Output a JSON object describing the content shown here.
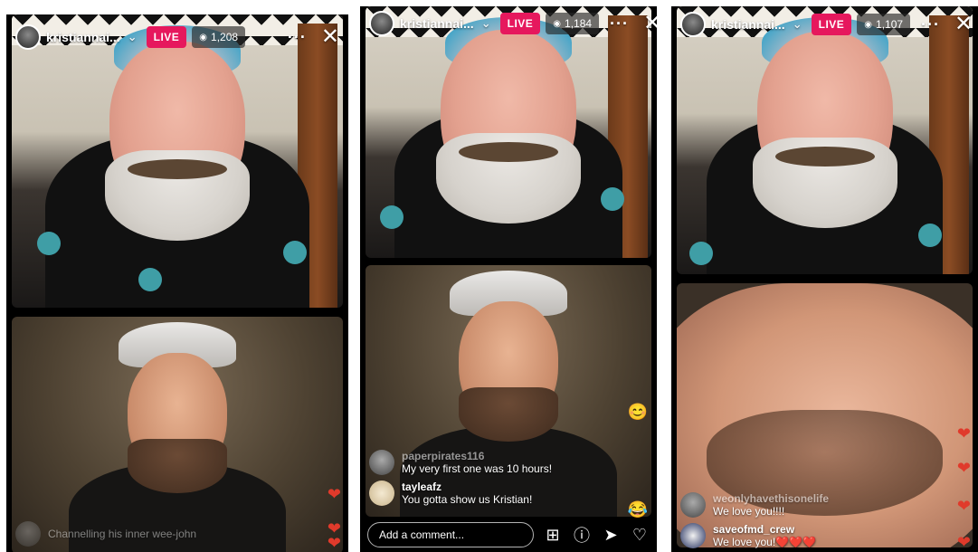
{
  "screens": [
    {
      "header": {
        "username": "kristiannai...",
        "live_label": "LIVE",
        "viewer_count": "1,208"
      },
      "comments": [
        {
          "user": "",
          "text": "Channelling his inner wee-john",
          "faded": true
        }
      ]
    },
    {
      "header": {
        "username": "kristiannai...",
        "live_label": "LIVE",
        "viewer_count": "1,184"
      },
      "comments": [
        {
          "user": "paperpirates116",
          "text": "My very first one was 10 hours!"
        },
        {
          "user": "tayleafz",
          "text": "You gotta show us Kristian!"
        }
      ],
      "bottom_bar": {
        "comment_placeholder": "Add a comment..."
      }
    },
    {
      "header": {
        "username": "kristiannai...",
        "live_label": "LIVE",
        "viewer_count": "1,107"
      },
      "comments": [
        {
          "user": "weonlyhavethisonelife",
          "text": "We love you!!!!"
        },
        {
          "user": "saveofmd_crew",
          "text": "We love you!❤️❤️❤️"
        }
      ]
    }
  ],
  "icons": {
    "viewers": "eye-icon",
    "more": "more-icon",
    "close": "close-icon",
    "dropdown": "chevron-down-icon",
    "heart": "heart-icon",
    "add_guest": "add-guest-icon",
    "question": "question-icon",
    "share": "send-icon",
    "like": "like-icon"
  },
  "colors": {
    "live_badge": "#e6185d",
    "heart": "#e03a2b"
  }
}
